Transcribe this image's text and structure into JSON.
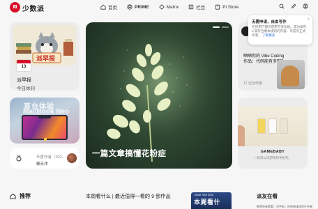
{
  "brand": {
    "logo_char": "π",
    "name": "少数派"
  },
  "nav": [
    {
      "label": "首页",
      "icon": "home-icon"
    },
    {
      "label": "PRIME",
      "icon": "prime-icon"
    },
    {
      "label": "Matrix",
      "icon": "matrix-icon"
    },
    {
      "label": "栏目",
      "icon": "column-icon"
    },
    {
      "label": "Pi Store",
      "icon": "store-icon"
    }
  ],
  "toolbar_icons": [
    "search-icon",
    "edit-icon",
    "user-icon"
  ],
  "left_card_1": {
    "date_num": "13",
    "title": "派早报",
    "subtitle": "今日休刊"
  },
  "left_card_2": {
    "line1": "首台体验",
    "line2": "MacBook Neo"
  },
  "left_card_3": {
    "meta": "年度作者（202…",
    "name": "柳天冲"
  },
  "hero": {
    "title": "一篇文章搞懂花粉症"
  },
  "notice": {
    "title": "无需申请，自由写作",
    "body": "任何用户都可使用写作功能。成功发布 3 篇符合版本规则的内容，可成为正式作者。",
    "link": "了解更多"
  },
  "right_card_1": {
    "title": "晒晒你的 Vibe Coding 作品：代码能有多野？",
    "meta": "17 位创作者"
  },
  "right_card_2": {
    "title": "GAMEBABY",
    "subtitle": "一款可以玩游戏的手机壳。"
  },
  "bottom": {
    "recommend": "推荐",
    "weekly": "本周看什么 | 最近值得一看的 9 部作品",
    "thumb_small": "Movie Time 2025",
    "thumb_big": "本周看什",
    "friends": "派友在看",
    "friends_line": "推荐你来看看：对不起，你的阅读体验正在被系统偷走…"
  }
}
